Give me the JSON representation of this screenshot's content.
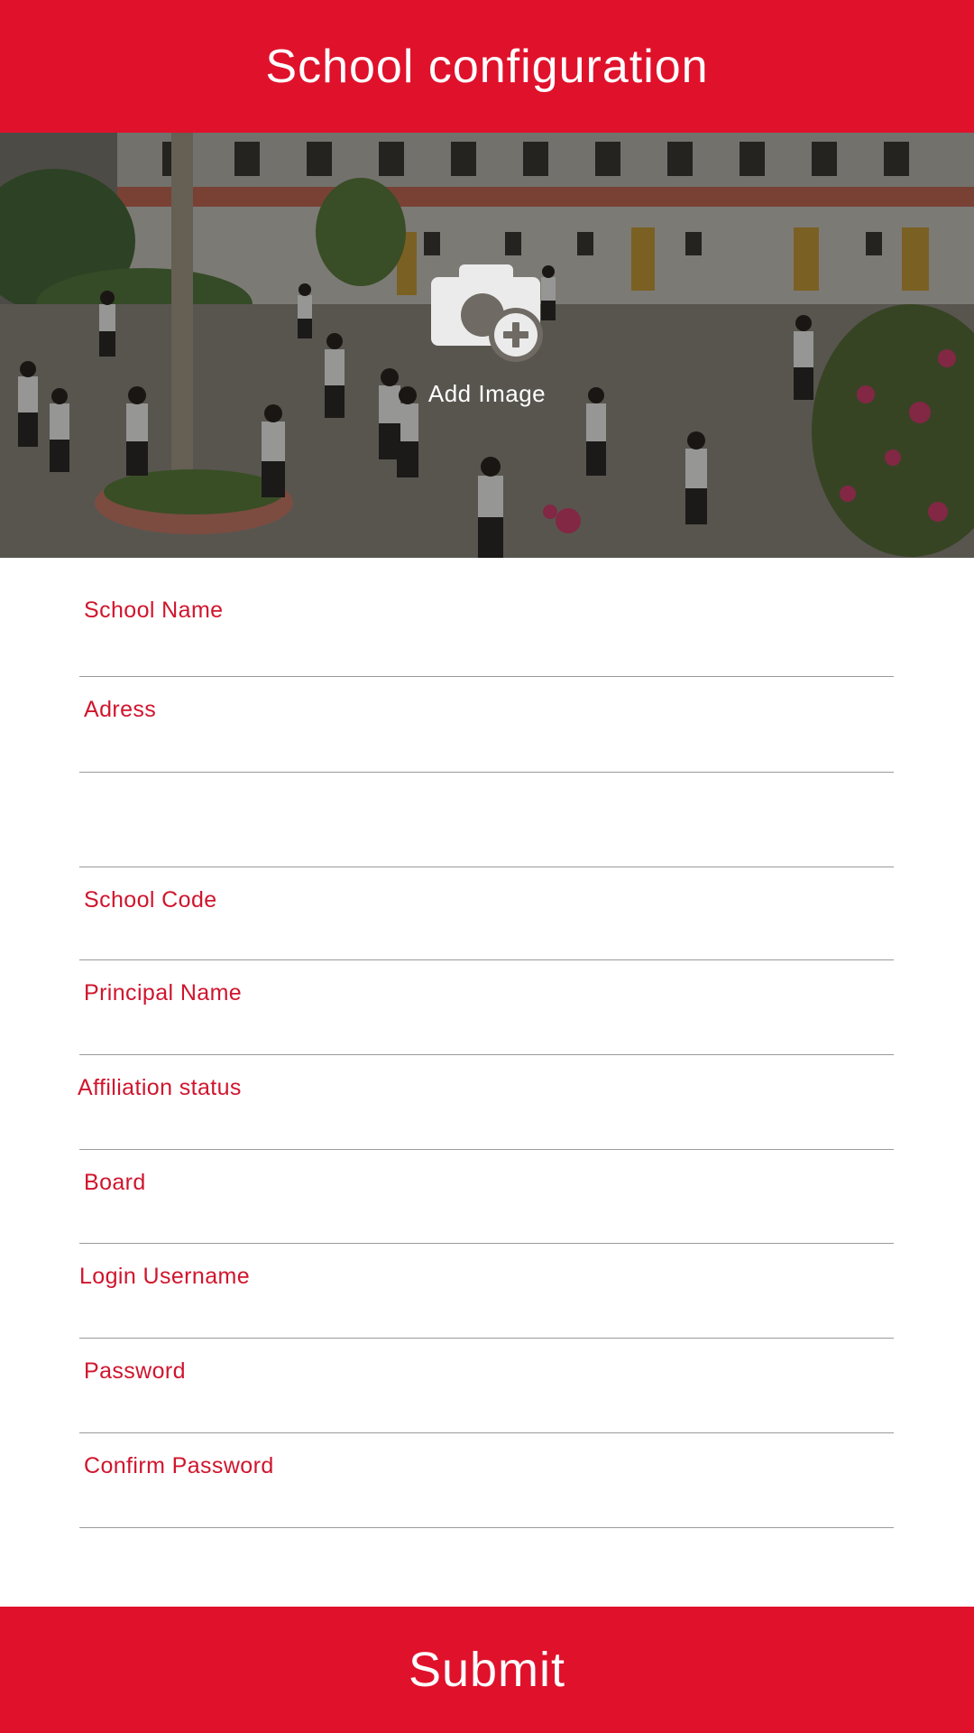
{
  "header": {
    "title": "School configuration"
  },
  "banner": {
    "add_image_label": "Add Image",
    "icon": "camera-add-icon"
  },
  "form": {
    "fields": [
      {
        "label": "School Name",
        "value": ""
      },
      {
        "label": "Adress",
        "value": ""
      },
      {
        "label": "",
        "value": ""
      },
      {
        "label": "School Code",
        "value": ""
      },
      {
        "label": "Principal Name",
        "value": ""
      },
      {
        "label": "Affiliation status",
        "value": ""
      },
      {
        "label": "Board",
        "value": ""
      },
      {
        "label": "Login Username",
        "value": ""
      },
      {
        "label": "Password",
        "value": ""
      },
      {
        "label": "Confirm Password",
        "value": ""
      }
    ]
  },
  "footer": {
    "submit_label": "Submit"
  },
  "colors": {
    "primary": "#e0112b",
    "label": "#d0152d",
    "divider": "#9a9a9a"
  }
}
